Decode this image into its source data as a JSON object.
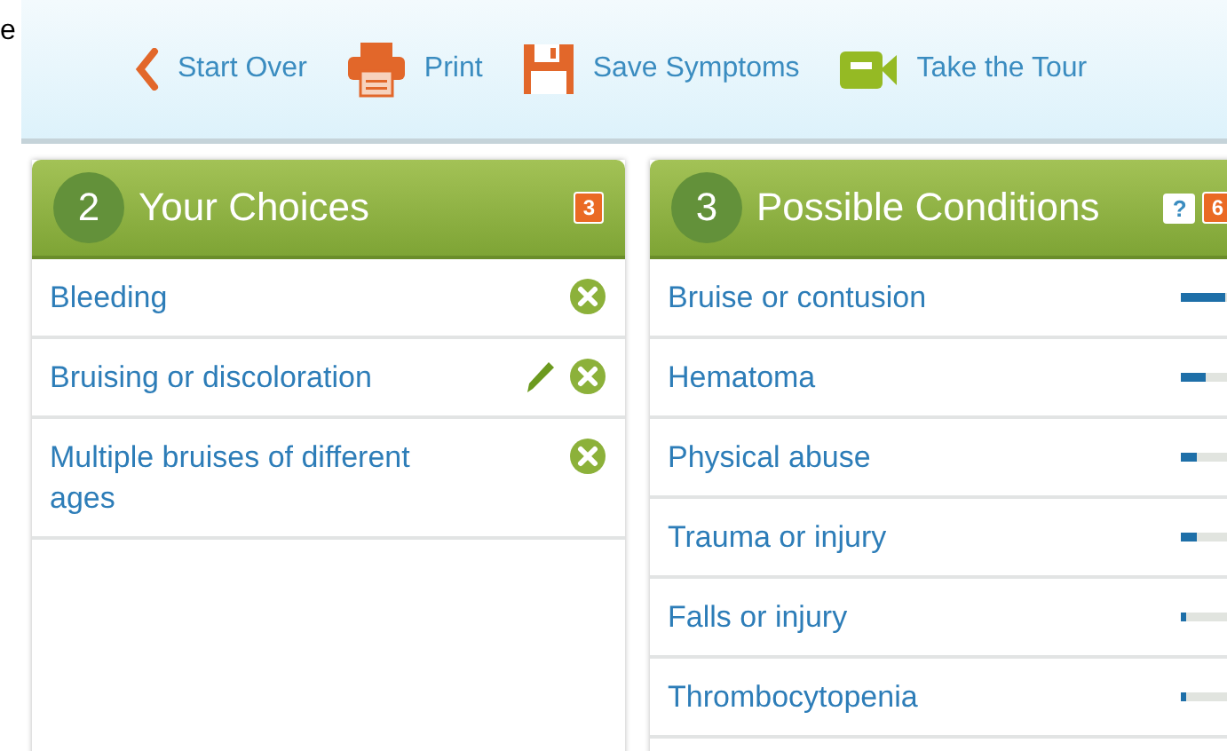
{
  "corner_text": "e",
  "toolbar": [
    {
      "kind": "back",
      "label": "Start Over"
    },
    {
      "kind": "print",
      "label": "Print"
    },
    {
      "kind": "save",
      "label": "Save Symptoms"
    },
    {
      "kind": "tour",
      "label": "Take the Tour"
    }
  ],
  "choices_panel": {
    "step": "2",
    "title": "Your Choices",
    "count": "3",
    "items": [
      {
        "label": "Bleeding",
        "editable": false
      },
      {
        "label": "Bruising or discoloration",
        "editable": true
      },
      {
        "label": "Multiple bruises of different ages",
        "editable": false
      }
    ]
  },
  "conditions_panel": {
    "step": "3",
    "title": "Possible Conditions",
    "help": "?",
    "count": "6",
    "items": [
      {
        "label": "Bruise or contusion",
        "level": 0.6
      },
      {
        "label": "Hematoma",
        "level": 0.33
      },
      {
        "label": "Physical abuse",
        "level": 0.22
      },
      {
        "label": "Trauma or injury",
        "level": 0.22
      },
      {
        "label": "Falls or injury",
        "level": 0.08
      },
      {
        "label": "Thrombocytopenia",
        "level": 0.08
      }
    ]
  }
}
